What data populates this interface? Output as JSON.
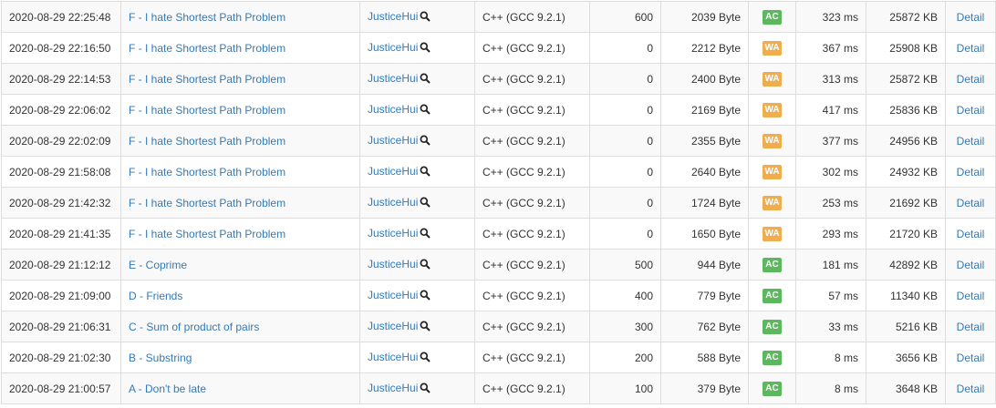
{
  "colors": {
    "AC": "#5cb85c",
    "WA": "#f0ad4e",
    "link": "#337ab7"
  },
  "submissions": [
    {
      "time": "2020-08-29 22:25:48",
      "task": "F - I hate Shortest Path Problem",
      "user": "JusticeHui",
      "language": "C++ (GCC 9.2.1)",
      "score": "600",
      "code_size": "2039 Byte",
      "status": "AC",
      "exec_time": "323 ms",
      "memory": "25872 KB",
      "detail": "Detail"
    },
    {
      "time": "2020-08-29 22:16:50",
      "task": "F - I hate Shortest Path Problem",
      "user": "JusticeHui",
      "language": "C++ (GCC 9.2.1)",
      "score": "0",
      "code_size": "2212 Byte",
      "status": "WA",
      "exec_time": "367 ms",
      "memory": "25908 KB",
      "detail": "Detail"
    },
    {
      "time": "2020-08-29 22:14:53",
      "task": "F - I hate Shortest Path Problem",
      "user": "JusticeHui",
      "language": "C++ (GCC 9.2.1)",
      "score": "0",
      "code_size": "2400 Byte",
      "status": "WA",
      "exec_time": "313 ms",
      "memory": "25872 KB",
      "detail": "Detail"
    },
    {
      "time": "2020-08-29 22:06:02",
      "task": "F - I hate Shortest Path Problem",
      "user": "JusticeHui",
      "language": "C++ (GCC 9.2.1)",
      "score": "0",
      "code_size": "2169 Byte",
      "status": "WA",
      "exec_time": "417 ms",
      "memory": "25836 KB",
      "detail": "Detail"
    },
    {
      "time": "2020-08-29 22:02:09",
      "task": "F - I hate Shortest Path Problem",
      "user": "JusticeHui",
      "language": "C++ (GCC 9.2.1)",
      "score": "0",
      "code_size": "2355 Byte",
      "status": "WA",
      "exec_time": "377 ms",
      "memory": "24956 KB",
      "detail": "Detail"
    },
    {
      "time": "2020-08-29 21:58:08",
      "task": "F - I hate Shortest Path Problem",
      "user": "JusticeHui",
      "language": "C++ (GCC 9.2.1)",
      "score": "0",
      "code_size": "2640 Byte",
      "status": "WA",
      "exec_time": "302 ms",
      "memory": "24932 KB",
      "detail": "Detail"
    },
    {
      "time": "2020-08-29 21:42:32",
      "task": "F - I hate Shortest Path Problem",
      "user": "JusticeHui",
      "language": "C++ (GCC 9.2.1)",
      "score": "0",
      "code_size": "1724 Byte",
      "status": "WA",
      "exec_time": "253 ms",
      "memory": "21692 KB",
      "detail": "Detail"
    },
    {
      "time": "2020-08-29 21:41:35",
      "task": "F - I hate Shortest Path Problem",
      "user": "JusticeHui",
      "language": "C++ (GCC 9.2.1)",
      "score": "0",
      "code_size": "1650 Byte",
      "status": "WA",
      "exec_time": "293 ms",
      "memory": "21720 KB",
      "detail": "Detail"
    },
    {
      "time": "2020-08-29 21:12:12",
      "task": "E - Coprime",
      "user": "JusticeHui",
      "language": "C++ (GCC 9.2.1)",
      "score": "500",
      "code_size": "944 Byte",
      "status": "AC",
      "exec_time": "181 ms",
      "memory": "42892 KB",
      "detail": "Detail"
    },
    {
      "time": "2020-08-29 21:09:00",
      "task": "D - Friends",
      "user": "JusticeHui",
      "language": "C++ (GCC 9.2.1)",
      "score": "400",
      "code_size": "779 Byte",
      "status": "AC",
      "exec_time": "57 ms",
      "memory": "11340 KB",
      "detail": "Detail"
    },
    {
      "time": "2020-08-29 21:06:31",
      "task": "C - Sum of product of pairs",
      "user": "JusticeHui",
      "language": "C++ (GCC 9.2.1)",
      "score": "300",
      "code_size": "762 Byte",
      "status": "AC",
      "exec_time": "33 ms",
      "memory": "5216 KB",
      "detail": "Detail"
    },
    {
      "time": "2020-08-29 21:02:30",
      "task": "B - Substring",
      "user": "JusticeHui",
      "language": "C++ (GCC 9.2.1)",
      "score": "200",
      "code_size": "588 Byte",
      "status": "AC",
      "exec_time": "8 ms",
      "memory": "3656 KB",
      "detail": "Detail"
    },
    {
      "time": "2020-08-29 21:00:57",
      "task": "A - Don't be late",
      "user": "JusticeHui",
      "language": "C++ (GCC 9.2.1)",
      "score": "100",
      "code_size": "379 Byte",
      "status": "AC",
      "exec_time": "8 ms",
      "memory": "3648 KB",
      "detail": "Detail"
    }
  ]
}
